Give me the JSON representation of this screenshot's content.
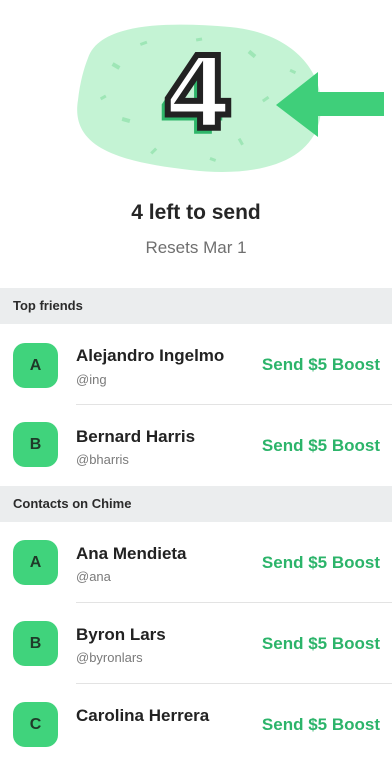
{
  "summary": {
    "remaining_number": "4",
    "left_to_send": "4 left to send",
    "resets": "Resets Mar 1"
  },
  "colors": {
    "accent": "#2cb46a",
    "avatar_bg": "#40d37c",
    "hero_blob": "#c4f3d4",
    "arrow": "#3fcf7a",
    "section_bg": "#ebedee"
  },
  "sections": [
    {
      "title": "Top friends",
      "rows": [
        {
          "initial": "A",
          "name": "Alejandro Ingelmo",
          "handle": "@ing",
          "action": "Send $5 Boost"
        },
        {
          "initial": "B",
          "name": "Bernard Harris",
          "handle": "@bharris",
          "action": "Send $5 Boost"
        }
      ]
    },
    {
      "title": "Contacts on Chime",
      "rows": [
        {
          "initial": "A",
          "name": "Ana Mendieta",
          "handle": "@ana",
          "action": "Send $5 Boost"
        },
        {
          "initial": "B",
          "name": "Byron Lars",
          "handle": "@byronlars",
          "action": "Send $5 Boost"
        },
        {
          "initial": "C",
          "name": "Carolina Herrera",
          "handle": "",
          "action": "Send $5 Boost"
        }
      ]
    }
  ]
}
